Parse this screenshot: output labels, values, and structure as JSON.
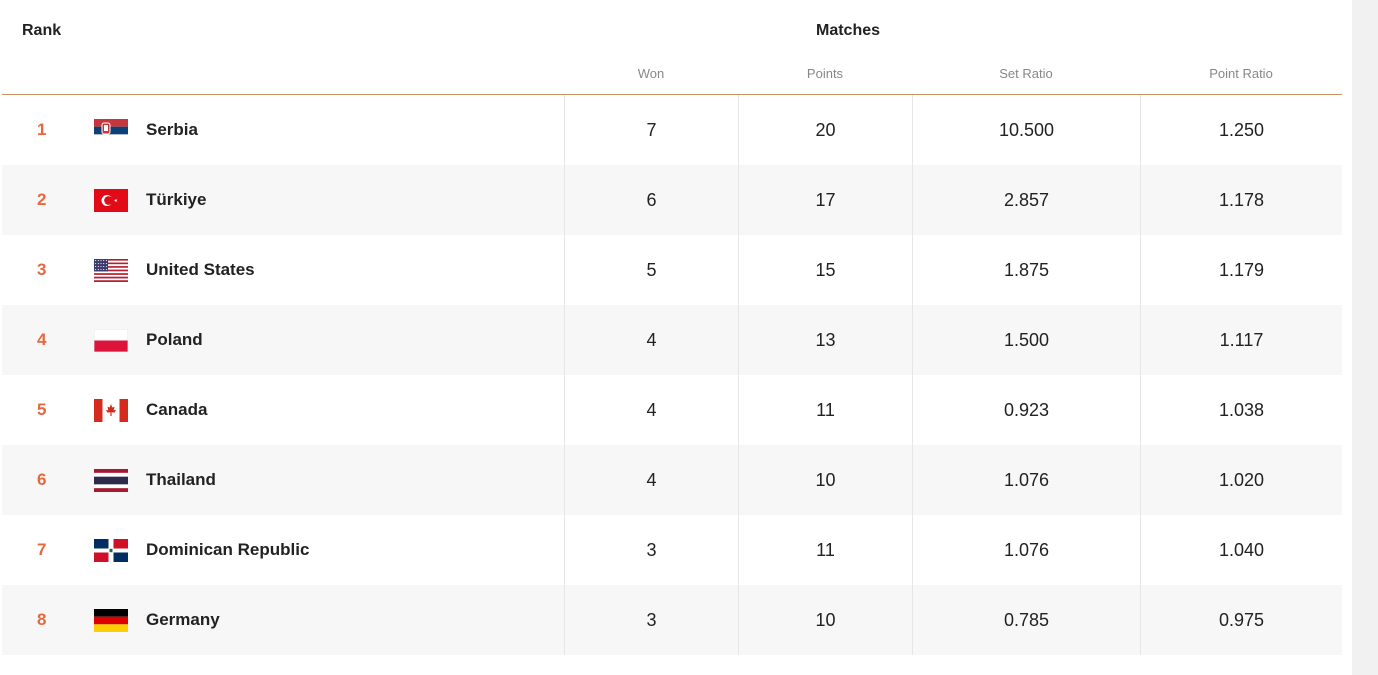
{
  "header": {
    "rank_label": "Rank",
    "matches_label": "Matches",
    "columns": {
      "won": "Won",
      "points": "Points",
      "set_ratio": "Set Ratio",
      "point_ratio": "Point Ratio"
    }
  },
  "rows": [
    {
      "rank": "1",
      "country": "Serbia",
      "flag": "serbia-flag-icon",
      "won": "7",
      "points": "20",
      "set_ratio": "10.500",
      "point_ratio": "1.250"
    },
    {
      "rank": "2",
      "country": "Türkiye",
      "flag": "turkiye-flag-icon",
      "won": "6",
      "points": "17",
      "set_ratio": "2.857",
      "point_ratio": "1.178"
    },
    {
      "rank": "3",
      "country": "United States",
      "flag": "united-states-flag-icon",
      "won": "5",
      "points": "15",
      "set_ratio": "1.875",
      "point_ratio": "1.179"
    },
    {
      "rank": "4",
      "country": "Poland",
      "flag": "poland-flag-icon",
      "won": "4",
      "points": "13",
      "set_ratio": "1.500",
      "point_ratio": "1.117"
    },
    {
      "rank": "5",
      "country": "Canada",
      "flag": "canada-flag-icon",
      "won": "4",
      "points": "11",
      "set_ratio": "0.923",
      "point_ratio": "1.038"
    },
    {
      "rank": "6",
      "country": "Thailand",
      "flag": "thailand-flag-icon",
      "won": "4",
      "points": "10",
      "set_ratio": "1.076",
      "point_ratio": "1.020"
    },
    {
      "rank": "7",
      "country": "Dominican Republic",
      "flag": "dominican-republic-flag-icon",
      "won": "3",
      "points": "11",
      "set_ratio": "1.076",
      "point_ratio": "1.040"
    },
    {
      "rank": "8",
      "country": "Germany",
      "flag": "germany-flag-icon",
      "won": "3",
      "points": "10",
      "set_ratio": "0.785",
      "point_ratio": "0.975"
    }
  ],
  "colors": {
    "rank_accent": "#e8673c",
    "header_rule": "#c9925f"
  }
}
